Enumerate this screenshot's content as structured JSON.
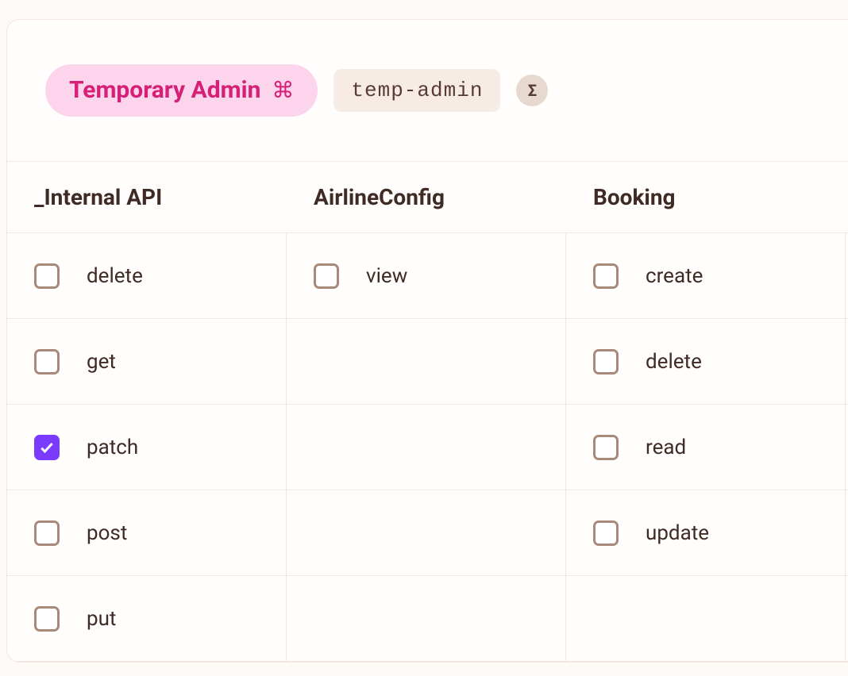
{
  "header": {
    "role_name": "Temporary Admin",
    "role_icon": "⌘",
    "slug": "temp-admin",
    "sigma": "Σ"
  },
  "columns": [
    {
      "title": "_Internal API"
    },
    {
      "title": "AirlineConfig"
    },
    {
      "title": "Booking"
    }
  ],
  "rows": [
    [
      {
        "label": "delete",
        "checked": false
      },
      {
        "label": "view",
        "checked": false
      },
      {
        "label": "create",
        "checked": false
      }
    ],
    [
      {
        "label": "get",
        "checked": false
      },
      null,
      {
        "label": "delete",
        "checked": false
      }
    ],
    [
      {
        "label": "patch",
        "checked": true
      },
      null,
      {
        "label": "read",
        "checked": false
      }
    ],
    [
      {
        "label": "post",
        "checked": false
      },
      null,
      {
        "label": "update",
        "checked": false
      }
    ],
    [
      {
        "label": "put",
        "checked": false
      },
      null,
      null
    ]
  ]
}
